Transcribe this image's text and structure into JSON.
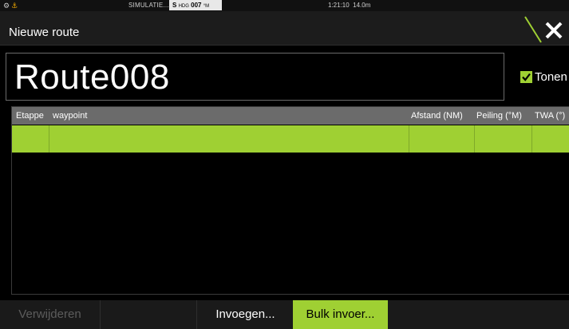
{
  "status_bar": {
    "icons": [
      "settings-icon",
      "anchor-icon"
    ],
    "simulation_label": "SIMULATIE...",
    "heading_prefix": "S",
    "heading_label": "HDG",
    "heading_value": "007",
    "heading_unit": "°M",
    "time": "1:21:10",
    "depth": "14.0m"
  },
  "title_bar": {
    "title": "Nieuwe route",
    "close_icon": "close-icon"
  },
  "route_name": {
    "value": "Route008"
  },
  "show_checkbox": {
    "label": "Tonen",
    "checked": true
  },
  "table": {
    "columns": [
      "Etappe",
      "waypoint",
      "Afstand (NM)",
      "Peiling (°M)",
      "TWA (°)"
    ],
    "rows": [
      {
        "etappe": "",
        "waypoint": "",
        "afstand": "",
        "peiling": "",
        "twa": "",
        "selected": true
      }
    ]
  },
  "toolbar": {
    "buttons": [
      {
        "label": "Verwijderen",
        "state": "disabled"
      },
      {
        "label": "",
        "state": "empty"
      },
      {
        "label": "Invoegen...",
        "state": "normal"
      },
      {
        "label": "Bulk invoer...",
        "state": "active"
      }
    ]
  },
  "colors": {
    "accent": "#9fd033",
    "background": "#000000",
    "header": "#6b6b6b",
    "title_bar": "#1c1c1c"
  }
}
